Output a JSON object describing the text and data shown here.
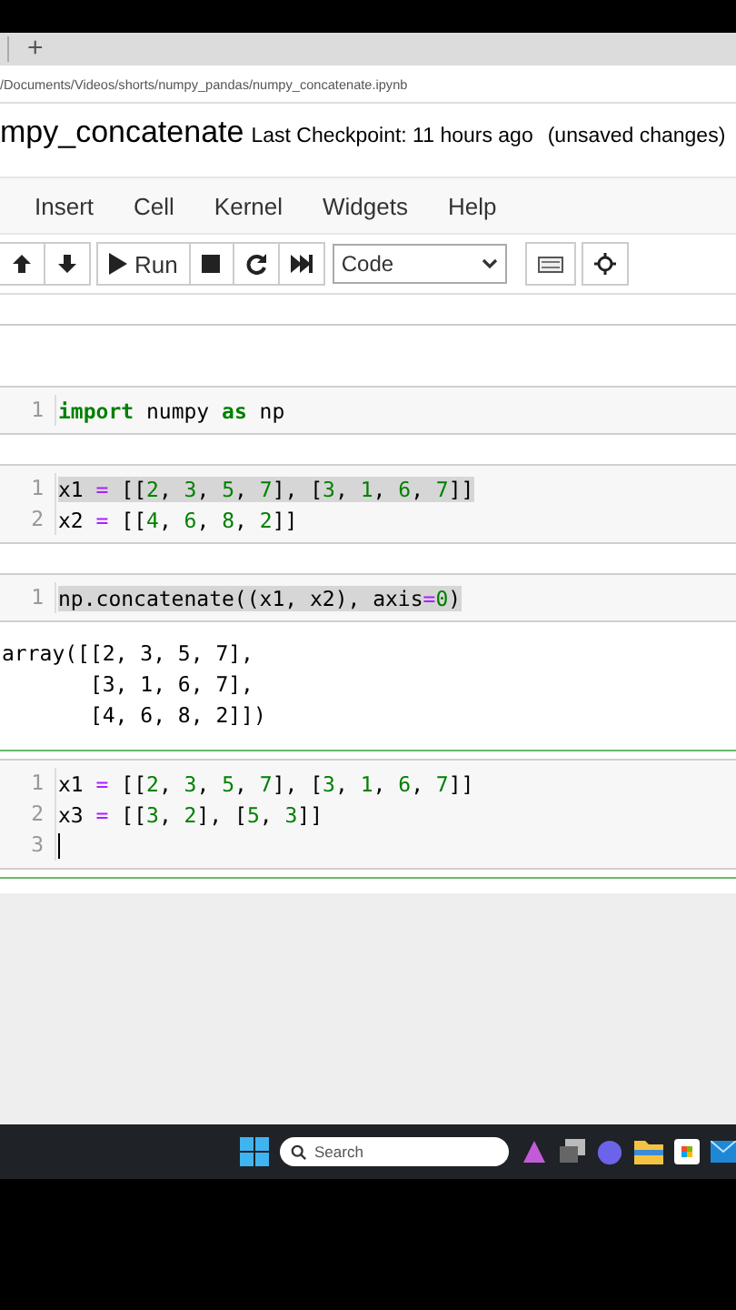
{
  "browser": {
    "new_tab": "+",
    "address": "/Documents/Videos/shorts/numpy_pandas/numpy_concatenate.ipynb"
  },
  "notebook": {
    "name": "mpy_concatenate",
    "checkpoint": "Last Checkpoint: 11 hours ago",
    "status": "(unsaved changes)"
  },
  "menu": [
    "Insert",
    "Cell",
    "Kernel",
    "Widgets",
    "Help"
  ],
  "toolbar": {
    "run_label": "Run",
    "cell_type": "Code"
  },
  "cells": [
    {
      "kind": "code",
      "selected": false,
      "lines": [
        {
          "number": "1",
          "highlighted": false,
          "tokens": [
            {
              "kind": "keyword",
              "text": "import"
            },
            {
              "kind": "plain",
              "text": " numpy "
            },
            {
              "kind": "keyword",
              "text": "as"
            },
            {
              "kind": "plain",
              "text": " np"
            }
          ]
        }
      ]
    },
    {
      "kind": "code",
      "selected": false,
      "lines": [
        {
          "number": "1",
          "highlighted": true,
          "tokens": [
            {
              "kind": "plain",
              "text": "x1 "
            },
            {
              "kind": "operator",
              "text": "="
            },
            {
              "kind": "plain",
              "text": " [["
            },
            {
              "kind": "number",
              "text": "2"
            },
            {
              "kind": "plain",
              "text": ", "
            },
            {
              "kind": "number",
              "text": "3"
            },
            {
              "kind": "plain",
              "text": ", "
            },
            {
              "kind": "number",
              "text": "5"
            },
            {
              "kind": "plain",
              "text": ", "
            },
            {
              "kind": "number",
              "text": "7"
            },
            {
              "kind": "plain",
              "text": "], ["
            },
            {
              "kind": "number",
              "text": "3"
            },
            {
              "kind": "plain",
              "text": ", "
            },
            {
              "kind": "number",
              "text": "1"
            },
            {
              "kind": "plain",
              "text": ", "
            },
            {
              "kind": "number",
              "text": "6"
            },
            {
              "kind": "plain",
              "text": ", "
            },
            {
              "kind": "number",
              "text": "7"
            },
            {
              "kind": "plain",
              "text": "]]"
            }
          ]
        },
        {
          "number": "2",
          "highlighted": false,
          "tokens": [
            {
              "kind": "plain",
              "text": "x2 "
            },
            {
              "kind": "operator",
              "text": "="
            },
            {
              "kind": "plain",
              "text": " [["
            },
            {
              "kind": "number",
              "text": "4"
            },
            {
              "kind": "plain",
              "text": ", "
            },
            {
              "kind": "number",
              "text": "6"
            },
            {
              "kind": "plain",
              "text": ", "
            },
            {
              "kind": "number",
              "text": "8"
            },
            {
              "kind": "plain",
              "text": ", "
            },
            {
              "kind": "number",
              "text": "2"
            },
            {
              "kind": "plain",
              "text": "]]"
            }
          ]
        }
      ]
    },
    {
      "kind": "code",
      "selected": false,
      "lines": [
        {
          "number": "1",
          "highlighted": true,
          "tokens": [
            {
              "kind": "plain",
              "text": "np.concatenate((x1, x2), axis"
            },
            {
              "kind": "operator",
              "text": "="
            },
            {
              "kind": "number",
              "text": "0"
            },
            {
              "kind": "plain",
              "text": ")"
            }
          ]
        }
      ]
    },
    {
      "kind": "output",
      "lines": [
        "array([[2, 3, 5, 7],",
        "       [3, 1, 6, 7],",
        "       [4, 6, 8, 2]])"
      ]
    },
    {
      "kind": "code",
      "selected": true,
      "lines": [
        {
          "number": "1",
          "highlighted": false,
          "tokens": [
            {
              "kind": "plain",
              "text": "x1 "
            },
            {
              "kind": "operator",
              "text": "="
            },
            {
              "kind": "plain",
              "text": " [["
            },
            {
              "kind": "number",
              "text": "2"
            },
            {
              "kind": "plain",
              "text": ", "
            },
            {
              "kind": "number",
              "text": "3"
            },
            {
              "kind": "plain",
              "text": ", "
            },
            {
              "kind": "number",
              "text": "5"
            },
            {
              "kind": "plain",
              "text": ", "
            },
            {
              "kind": "number",
              "text": "7"
            },
            {
              "kind": "plain",
              "text": "], ["
            },
            {
              "kind": "number",
              "text": "3"
            },
            {
              "kind": "plain",
              "text": ", "
            },
            {
              "kind": "number",
              "text": "1"
            },
            {
              "kind": "plain",
              "text": ", "
            },
            {
              "kind": "number",
              "text": "6"
            },
            {
              "kind": "plain",
              "text": ", "
            },
            {
              "kind": "number",
              "text": "7"
            },
            {
              "kind": "plain",
              "text": "]]"
            }
          ]
        },
        {
          "number": "2",
          "highlighted": false,
          "tokens": [
            {
              "kind": "plain",
              "text": "x3 "
            },
            {
              "kind": "operator",
              "text": "="
            },
            {
              "kind": "plain",
              "text": " [["
            },
            {
              "kind": "number",
              "text": "3"
            },
            {
              "kind": "plain",
              "text": ", "
            },
            {
              "kind": "number",
              "text": "2"
            },
            {
              "kind": "plain",
              "text": "], ["
            },
            {
              "kind": "number",
              "text": "5"
            },
            {
              "kind": "plain",
              "text": ", "
            },
            {
              "kind": "number",
              "text": "3"
            },
            {
              "kind": "plain",
              "text": "]]"
            }
          ]
        },
        {
          "number": "3",
          "cursor": true
        }
      ]
    }
  ],
  "taskbar": {
    "search_placeholder": "Search"
  }
}
